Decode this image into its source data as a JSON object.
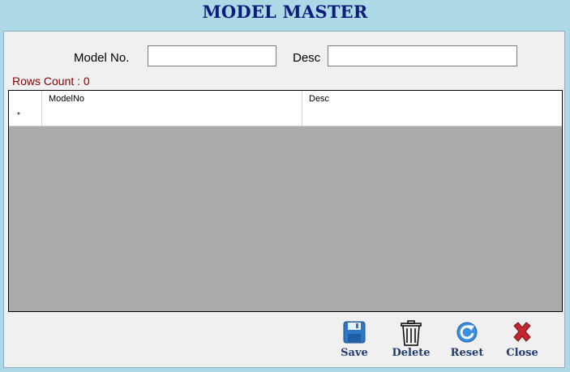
{
  "window": {
    "title": "MODEL MASTER"
  },
  "form": {
    "model_no_label": "Model No.",
    "model_no_value": "",
    "desc_label": "Desc",
    "desc_value": ""
  },
  "rows_count_text": "Rows Count : 0",
  "grid": {
    "columns": [
      "ModelNo",
      "Desc"
    ],
    "new_row_marker": "*",
    "rows": []
  },
  "buttons": {
    "save": {
      "label": "Save",
      "icon": "save-icon"
    },
    "delete": {
      "label": "Delete",
      "icon": "trash-icon"
    },
    "reset": {
      "label": "Reset",
      "icon": "refresh-icon"
    },
    "close": {
      "label": "Close",
      "icon": "close-icon"
    }
  },
  "colors": {
    "background": "#add8e6",
    "title": "#0d1c7a",
    "rows_count": "#8b0000",
    "grid_empty": "#ababab",
    "button_label": "#1f3b73"
  }
}
